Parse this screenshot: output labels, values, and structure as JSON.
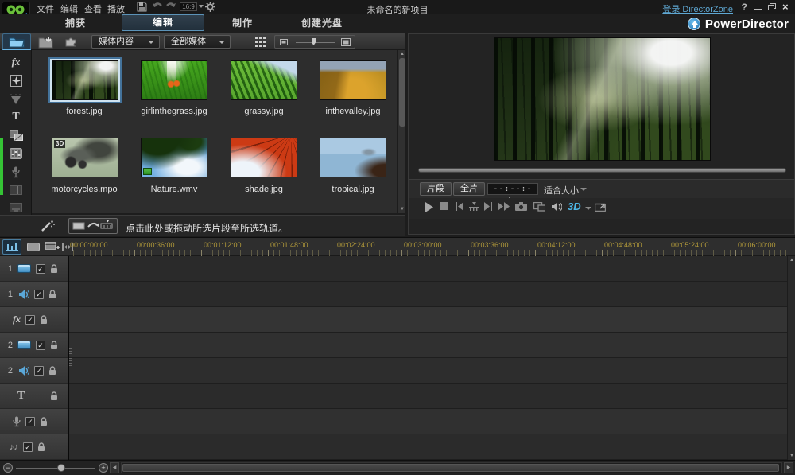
{
  "titlebar": {
    "menus": [
      "文件",
      "编辑",
      "查看",
      "播放"
    ],
    "aspect_ratio": "16:9",
    "project_title": "未命名的新项目",
    "login_label": "登录 DirectorZone",
    "help": "?"
  },
  "tabs": [
    {
      "label": "捕获",
      "active": false
    },
    {
      "label": "编辑",
      "active": true
    },
    {
      "label": "制作",
      "active": false
    },
    {
      "label": "创建光盘",
      "active": false
    }
  ],
  "brand": {
    "name": "PowerDirector"
  },
  "library": {
    "content_dropdown": "媒体内容",
    "filter_dropdown": "全部媒体",
    "items": [
      {
        "name": "forest.jpg",
        "selected": true
      },
      {
        "name": "girlinthegrass.jpg"
      },
      {
        "name": "grassy.jpg"
      },
      {
        "name": "inthevalley.jpg"
      },
      {
        "name": "motorcycles.mpo",
        "badge": "3D"
      },
      {
        "name": "Nature.wmv"
      },
      {
        "name": "shade.jpg"
      },
      {
        "name": "tropical.jpg"
      }
    ],
    "hint": "点击此处或拖动所选片段至所选轨道。"
  },
  "preview": {
    "clip_button": "片段",
    "movie_button": "全片",
    "timecode": "--:--:--:--",
    "zoom_select": "适合大小",
    "mode_3d": "3D"
  },
  "timeline": {
    "ruler": [
      "00:00:00:00",
      "00:00:36:00",
      "00:01:12:00",
      "00:01:48:00",
      "00:02:24:00",
      "00:03:00:00",
      "00:03:36:00",
      "00:04:12:00",
      "00:04:48:00",
      "00:05:24:00",
      "00:06:00:00"
    ],
    "tracks": [
      {
        "label": "1",
        "type": "video"
      },
      {
        "label": "1",
        "type": "audio"
      },
      {
        "label": "fx",
        "type": "effect"
      },
      {
        "label": "2",
        "type": "video"
      },
      {
        "label": "2",
        "type": "audio"
      },
      {
        "label": "T",
        "type": "title"
      },
      {
        "label": "",
        "type": "voice"
      },
      {
        "label": "♪♪",
        "type": "music"
      }
    ]
  },
  "icons": {
    "check": "✓",
    "up": "▲",
    "down": "▼",
    "left": "◀",
    "right": "▶",
    "flyout": "▶",
    "close": "×",
    "plus": "+",
    "minus": "−"
  },
  "colors": {
    "accent": "#4aa3d8",
    "ruler_text": "#b0983a",
    "green_strip": "#35c435",
    "blue_3d": "#4db8e8"
  }
}
